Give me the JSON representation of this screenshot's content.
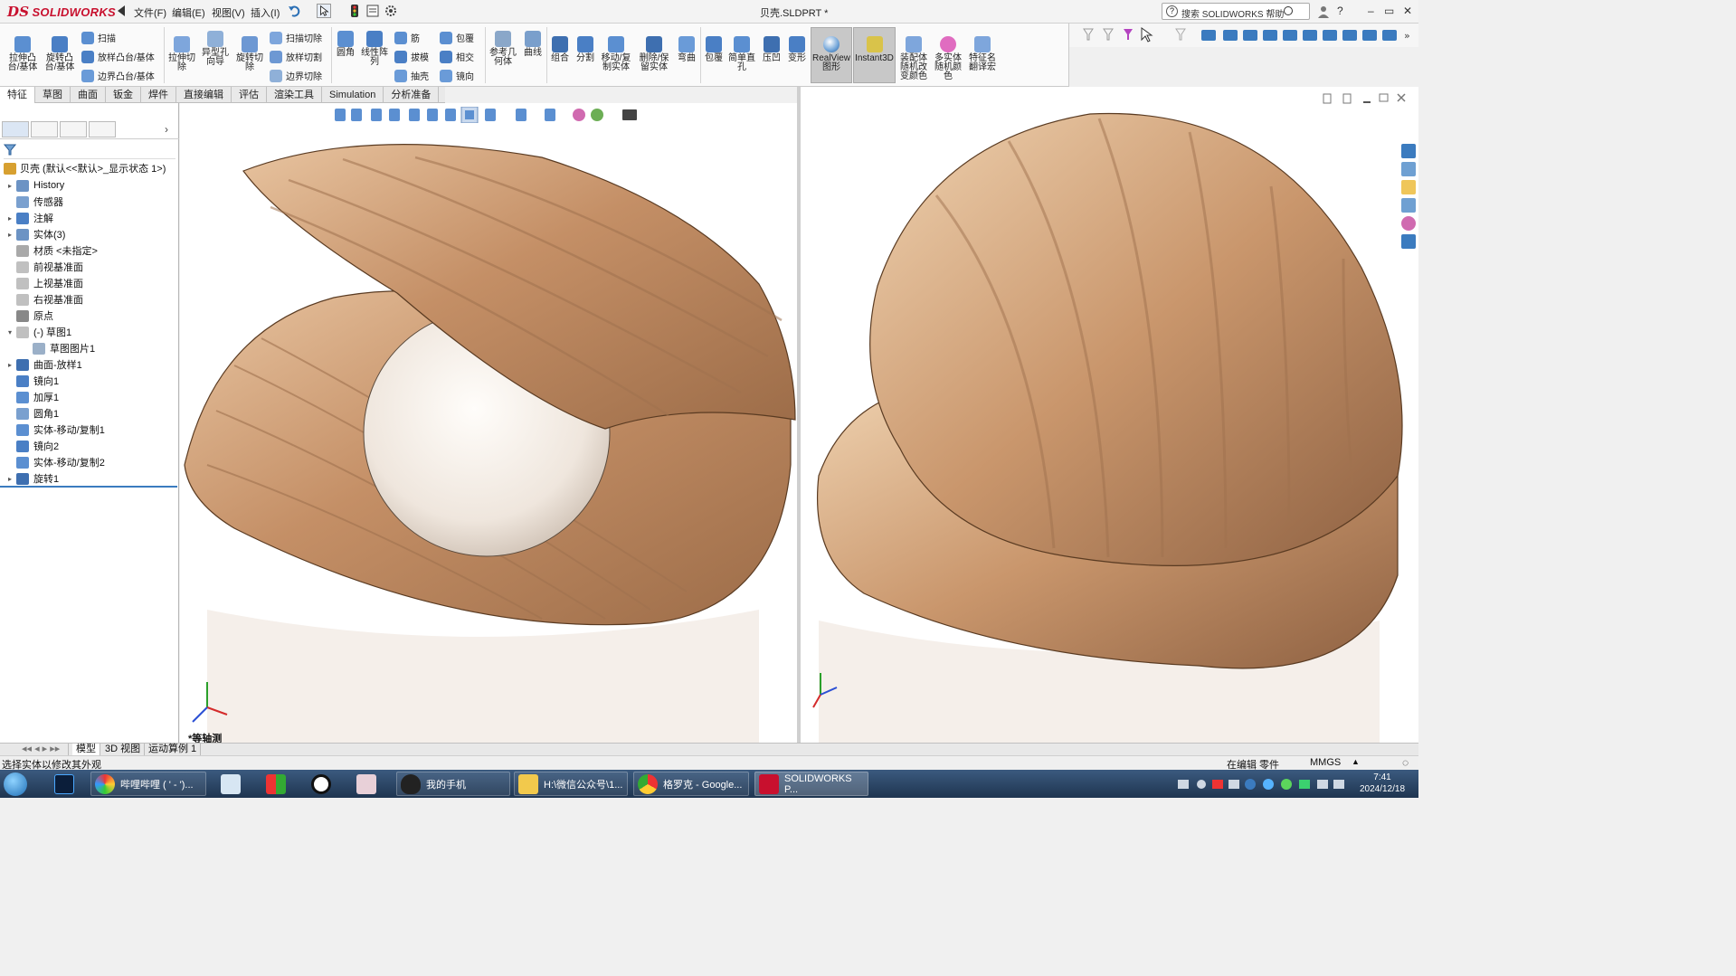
{
  "app": {
    "brand": "SOLIDWORKS",
    "document_title": "贝壳.SLDPRT *",
    "menus": [
      "文件(F)",
      "编辑(E)",
      "视图(V)",
      "插入(I)"
    ],
    "help_search_placeholder": "搜索 SOLIDWORKS 帮助"
  },
  "ribbon": {
    "buttons": [
      {
        "label": "拉伸凸\n台/基体",
        "icon": "extrude-boss-icon"
      },
      {
        "label": "旋转凸\n台/基体",
        "icon": "revolve-boss-icon"
      },
      {
        "label": "拉伸切\n除",
        "icon": "extrude-cut-icon"
      },
      {
        "label": "异型孔\n向导",
        "icon": "hole-wizard-icon"
      },
      {
        "label": "旋转切\n除",
        "icon": "revolve-cut-icon"
      },
      {
        "label": "圆角",
        "icon": "fillet-icon"
      },
      {
        "label": "线性阵\n列",
        "icon": "linear-pattern-icon"
      },
      {
        "label": "参考几\n何体",
        "icon": "reference-geometry-icon"
      },
      {
        "label": "曲线",
        "icon": "curves-icon"
      },
      {
        "label": "组合",
        "icon": "combine-icon"
      },
      {
        "label": "分割",
        "icon": "split-icon"
      },
      {
        "label": "移动/复\n制实体",
        "icon": "move-copy-body-icon"
      },
      {
        "label": "删除/保\n留实体",
        "icon": "delete-keep-body-icon"
      },
      {
        "label": "弯曲",
        "icon": "flex-icon"
      },
      {
        "label": "包覆",
        "icon": "wrap-icon"
      },
      {
        "label": "简单直\n孔",
        "icon": "simple-hole-icon"
      },
      {
        "label": "压凹",
        "icon": "indent-icon"
      },
      {
        "label": "变形",
        "icon": "deform-icon"
      },
      {
        "label": "RealView\n图形",
        "icon": "realview-icon"
      },
      {
        "label": "Instant3D",
        "icon": "instant3d-icon"
      },
      {
        "label": "装配体\n随机改\n变颜色",
        "icon": "assembly-random-color-icon"
      },
      {
        "label": "多实体\n随机颜\n色",
        "icon": "multibody-random-color-icon"
      },
      {
        "label": "特征名\n翻译宏",
        "icon": "feature-translate-macro-icon"
      }
    ],
    "small_buttons": [
      {
        "label": "扫描",
        "icon": "sweep-icon"
      },
      {
        "label": "放样凸台/基体",
        "icon": "loft-boss-icon"
      },
      {
        "label": "边界凸台/基体",
        "icon": "boundary-boss-icon"
      },
      {
        "label": "扫描切除",
        "icon": "swept-cut-icon"
      },
      {
        "label": "放样切割",
        "icon": "lofted-cut-icon"
      },
      {
        "label": "边界切除",
        "icon": "boundary-cut-icon"
      },
      {
        "label": "筋",
        "icon": "rib-icon"
      },
      {
        "label": "拔模",
        "icon": "draft-icon"
      },
      {
        "label": "抽壳",
        "icon": "shell-icon"
      },
      {
        "label": "包覆",
        "icon": "wrap-small-icon"
      },
      {
        "label": "相交",
        "icon": "intersect-icon"
      },
      {
        "label": "镜向",
        "icon": "mirror-icon"
      }
    ]
  },
  "tabs": [
    "特征",
    "草图",
    "曲面",
    "钣金",
    "焊件",
    "直接编辑",
    "评估",
    "渲染工具",
    "Simulation",
    "分析准备"
  ],
  "feature_tree": {
    "root": "贝壳 (默认<<默认>_显示状态 1>)",
    "items": [
      {
        "label": "History",
        "expandable": true
      },
      {
        "label": "传感器",
        "expandable": false
      },
      {
        "label": "注解",
        "expandable": true
      },
      {
        "label": "实体(3)",
        "expandable": true
      },
      {
        "label": "材质 <未指定>",
        "expandable": false
      },
      {
        "label": "前视基准面",
        "expandable": false
      },
      {
        "label": "上视基准面",
        "expandable": false
      },
      {
        "label": "右视基准面",
        "expandable": false
      },
      {
        "label": "原点",
        "expandable": false
      },
      {
        "label": "(-) 草图1",
        "expandable": true
      },
      {
        "label": "草图图片1",
        "expandable": false
      },
      {
        "label": "曲面-放样1",
        "expandable": true
      },
      {
        "label": "镜向1",
        "expandable": false
      },
      {
        "label": "加厚1",
        "expandable": false
      },
      {
        "label": "圆角1",
        "expandable": false
      },
      {
        "label": "实体-移动/复制1",
        "expandable": false
      },
      {
        "label": "镜向2",
        "expandable": false
      },
      {
        "label": "实体-移动/复制2",
        "expandable": false
      },
      {
        "label": "旋转1",
        "expandable": true
      }
    ]
  },
  "viewport": {
    "left_label": "*等轴测"
  },
  "bottom_tabs": [
    "模型",
    "3D 视图",
    "运动算例 1"
  ],
  "status": {
    "message": "选择实体以修改其外观",
    "mode": "在编辑 零件",
    "units": "MMGS"
  },
  "taskbar": {
    "tasks": [
      {
        "label": "哔哩哔哩 ( ' - ')...",
        "icon": "bilibili-icon"
      },
      {
        "label": "我的手机",
        "icon": "qq-icon"
      },
      {
        "label": "H:\\微信公众号\\1...",
        "icon": "folder-icon"
      },
      {
        "label": "格罗克 - Google...",
        "icon": "chrome-icon"
      },
      {
        "label": "SOLIDWORKS P...",
        "icon": "solidworks-icon"
      }
    ],
    "time": "7:41",
    "date": "2024/12/18"
  },
  "colors": {
    "accent": "#3b7bbf",
    "brand": "#c8102e",
    "shell": "#c99a72",
    "pearl": "#f3ede7"
  }
}
